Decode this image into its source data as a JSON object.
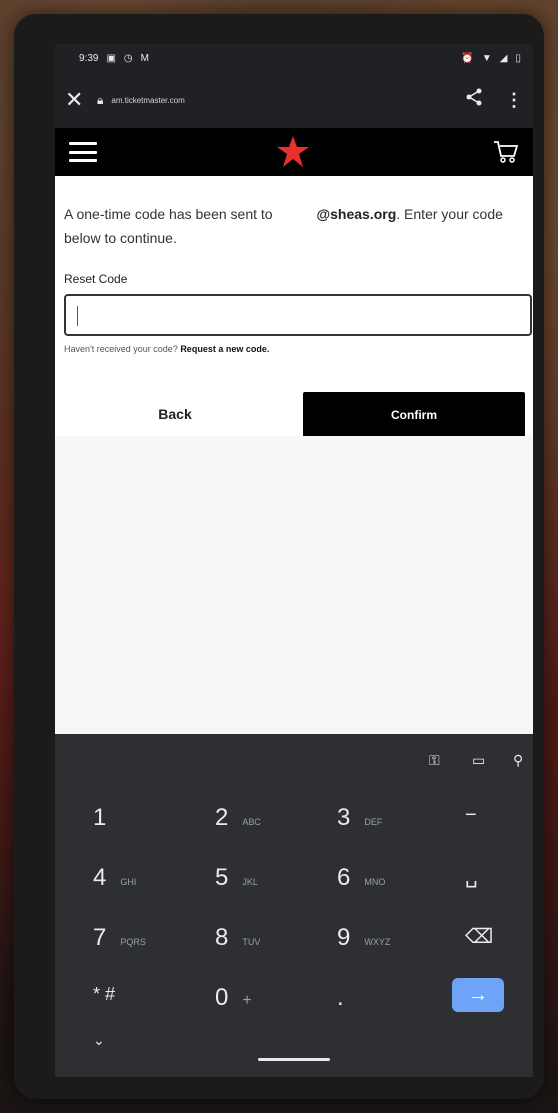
{
  "statusbar": {
    "time": "9:39",
    "left_icons": [
      "message-icon",
      "clock-icon",
      "gmail-icon"
    ],
    "right_icons": [
      "alarm-icon",
      "wifi-icon",
      "signal-icon",
      "battery-icon"
    ]
  },
  "browser": {
    "url": "am.ticketmaster.com"
  },
  "page": {
    "message_part1": "A one-time code has been sent to",
    "message_email": "@sheas.org",
    "message_part2": ". Enter your code below to continue.",
    "reset_label": "Reset Code",
    "code_value": "",
    "help_text": "Haven't received your code?",
    "help_link": "Request a new code.",
    "back_label": "Back",
    "confirm_label": "Confirm"
  },
  "keyboard": {
    "rows": [
      [
        {
          "main": "1",
          "sub": ""
        },
        {
          "main": "2",
          "sub": "ABC"
        },
        {
          "main": "3",
          "sub": "DEF"
        },
        {
          "main": "−",
          "sub": ""
        }
      ],
      [
        {
          "main": "4",
          "sub": "GHI"
        },
        {
          "main": "5",
          "sub": "JKL"
        },
        {
          "main": "6",
          "sub": "MNO"
        },
        {
          "main": "␣",
          "sub": ""
        }
      ],
      [
        {
          "main": "7",
          "sub": "PQRS"
        },
        {
          "main": "8",
          "sub": "TUV"
        },
        {
          "main": "9",
          "sub": "WXYZ"
        },
        {
          "main": "⌫",
          "sub": ""
        }
      ],
      [
        {
          "main": "* #",
          "sub": ""
        },
        {
          "main": "0",
          "sub": "+"
        },
        {
          "main": ".",
          "sub": ""
        }
      ]
    ],
    "enter_glyph": "→",
    "chevron_glyph": "⌄"
  },
  "colors": {
    "accent_star": "#e8312f",
    "confirm_bg": "#000000",
    "enter_key": "#6ea4f7"
  }
}
